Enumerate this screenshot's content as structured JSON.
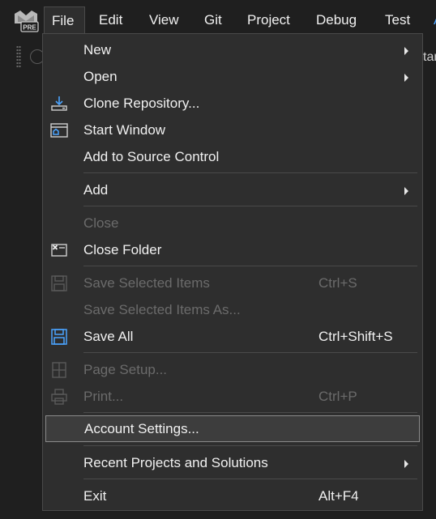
{
  "app": {
    "logo_icon": "visual-studio-preview-logo",
    "logo_badge": "PRE"
  },
  "menubar": {
    "items": [
      "File",
      "Edit",
      "View",
      "Git",
      "Project",
      "Debug",
      "Test",
      "A"
    ]
  },
  "toolbar": {
    "peek_text": "tar"
  },
  "file_menu": {
    "new": {
      "label": "New"
    },
    "open": {
      "label": "Open"
    },
    "clone_repository": {
      "label": "Clone Repository...",
      "icon": "clone-repo-icon"
    },
    "start_window": {
      "label": "Start Window",
      "icon": "start-window-icon"
    },
    "add_to_source_control": {
      "label": "Add to Source Control"
    },
    "add": {
      "label": "Add"
    },
    "close": {
      "label": "Close"
    },
    "close_folder": {
      "label": "Close Folder",
      "icon": "close-folder-icon"
    },
    "save_selected_items": {
      "label": "Save Selected Items",
      "shortcut": "Ctrl+S",
      "icon": "save-icon"
    },
    "save_selected_items_as": {
      "label": "Save Selected Items As..."
    },
    "save_all": {
      "label": "Save All",
      "shortcut": "Ctrl+Shift+S",
      "icon": "save-all-icon"
    },
    "page_setup": {
      "label": "Page Setup...",
      "icon": "page-setup-icon"
    },
    "print": {
      "label": "Print...",
      "shortcut": "Ctrl+P",
      "icon": "print-icon"
    },
    "account_settings": {
      "label": "Account Settings..."
    },
    "recent_projects": {
      "label": "Recent Projects and Solutions"
    },
    "exit": {
      "label": "Exit",
      "shortcut": "Alt+F4"
    }
  },
  "colors": {
    "menu_bg": "#2e2e2e",
    "app_bg": "#1f1f1f",
    "accent_blue": "#4aa3ff",
    "disabled_text": "#6b6b6b"
  }
}
